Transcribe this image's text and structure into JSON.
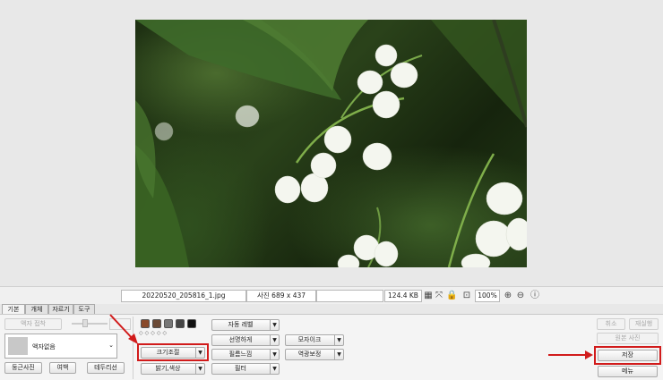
{
  "status": {
    "filename": "20220520_205816_1.jpg",
    "photo_size": "사진 689 x 437",
    "file_size": "124.4 KB",
    "zoom": "100%"
  },
  "tabs": [
    "기본",
    "개체",
    "자르기",
    "도구"
  ],
  "left_panel": {
    "frame_toggle_label": "액자 접착",
    "frame_select_value": "액자없음",
    "rounded_button": "둥근사진",
    "margin_button": "여백",
    "border_button": "테두리선"
  },
  "middle_panel": {
    "resize_button": "크기조절",
    "brightness_button": "밝기,색상",
    "auto_level_button": "자동 레벨",
    "sharpen_button": "선명하게",
    "film_feel_button": "필름느낌",
    "filter_button": "필터",
    "mosaic_button": "모자이크",
    "backlight_button": "역광보정"
  },
  "right_panel": {
    "undo_button": "취소",
    "redo_button": "재실행",
    "original_button": "원본 사진",
    "save_button": "저장",
    "menu_button": "메뉴"
  },
  "colors": {
    "highlight": "#d11b1b",
    "arrow": "#d11b1b"
  },
  "icons": [
    "lock-icon",
    "zoom-in-icon",
    "zoom-out-icon",
    "info-icon",
    "dropdown-arrow-icon"
  ]
}
